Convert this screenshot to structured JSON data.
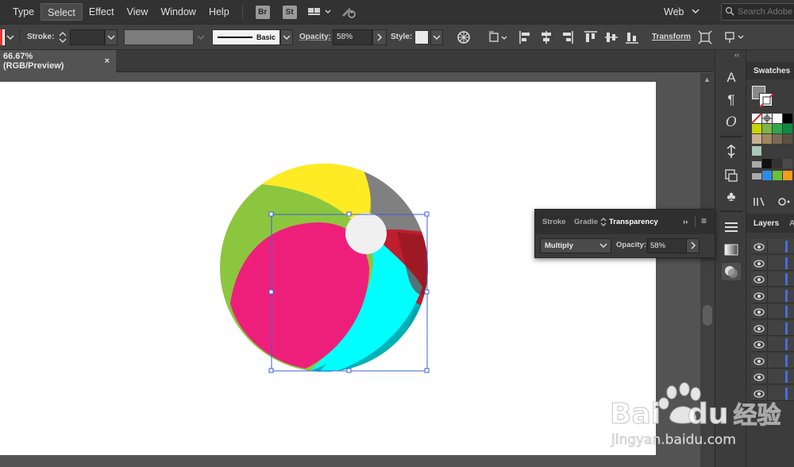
{
  "menubar": {
    "items": [
      "Type",
      "Select",
      "Effect",
      "View",
      "Window",
      "Help"
    ],
    "active": "Select",
    "bridge_label": "Br",
    "stock_label": "St",
    "workspace": "Web",
    "search_placeholder": "Search Adobe"
  },
  "controlbar": {
    "stroke_label": "Stroke:",
    "brush_label": "Basic",
    "opacity_label": "Opacity:",
    "opacity_value": "58%",
    "style_label": "Style:",
    "transform_label": "Transform"
  },
  "document": {
    "tab_title": "66.67% (RGB/Preview)",
    "close_symbol": "×"
  },
  "tools": {
    "glyphs": [
      "A",
      "¶",
      "O",
      "⊕",
      "◫",
      "♣",
      "≡",
      "▭",
      "◉"
    ]
  },
  "panels": {
    "swatches_title": "Swatches",
    "layers_title": "Layers",
    "layers_extra": "A",
    "layer_rows": 10,
    "collapse_symbol": "‹‹"
  },
  "transparency_panel": {
    "tabs": [
      "Stroke",
      "Gradie",
      "Transparency"
    ],
    "active_tab": "Transparency",
    "expand_symbol": "››",
    "menu_symbol": "≡",
    "blend_mode": "Multiply",
    "opacity_label": "Opacity:",
    "opacity_value": "58%"
  },
  "colors": {
    "yellow": "#FFEB24",
    "green": "#8CC63F",
    "gray": "#808080",
    "red": "#BE1E2D",
    "cyan": "#00FFFF",
    "teal": "#00B2B8",
    "pink": "#EE1F7A",
    "cap": "#F0F0F0",
    "selection": "#3A5FE0"
  },
  "watermark": {
    "brand": "Bai",
    "brand_suffix": "du",
    "chinese": "经验",
    "url": "jingyan.baidu.com"
  }
}
